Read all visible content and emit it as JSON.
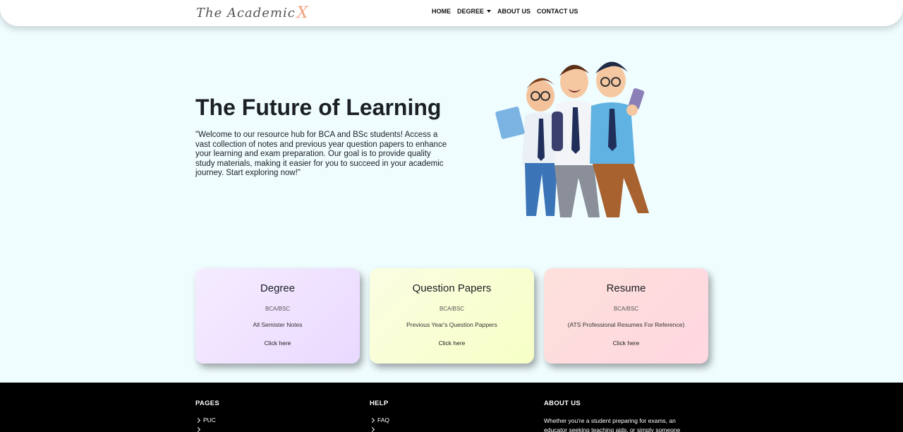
{
  "nav": {
    "logo_text": "The Academic",
    "logo_accent": "X",
    "links": [
      "HOME",
      "DEGREE",
      "ABOUT US",
      "CONTACT US"
    ]
  },
  "hero": {
    "title": "The Future of Learning",
    "text": "\"Welcome to our resource hub for BCA and BSc students! Access a vast collection of notes and previous year question papers to enhance your learning and exam preparation. Our goal is to provide quality study materials, making it easier for you to succeed in your academic journey. Start exploring now!\""
  },
  "cards": [
    {
      "title": "Degree",
      "sub": "BCA/BSC",
      "desc": "All Semister Notes",
      "link": "Click here"
    },
    {
      "title": "Question Papers",
      "sub": "BCA/BSC",
      "desc": "Previous Year's Question Pappers",
      "link": "Click here"
    },
    {
      "title": "Resume",
      "sub": "BCA/BSC",
      "desc": "(ATS Professional Resumes For Reference)",
      "link": "Click here"
    }
  ],
  "footer": {
    "pages": {
      "heading": "PAGES",
      "items": [
        "PUC",
        ""
      ]
    },
    "help": {
      "heading": "HELP",
      "items": [
        "FAQ",
        ""
      ]
    },
    "about": {
      "heading": "ABOUT US",
      "text": "Whether you're a student preparing for exams, an educator seeking teaching aids, or simply someone"
    }
  },
  "colors": {
    "page_bg": "#effdff",
    "card_degree": "#ead9ff",
    "card_papers": "#f7ffc6",
    "card_resume": "#ffd7e0",
    "logo_accent": "#f2a07b",
    "footer_bg": "#000000"
  }
}
